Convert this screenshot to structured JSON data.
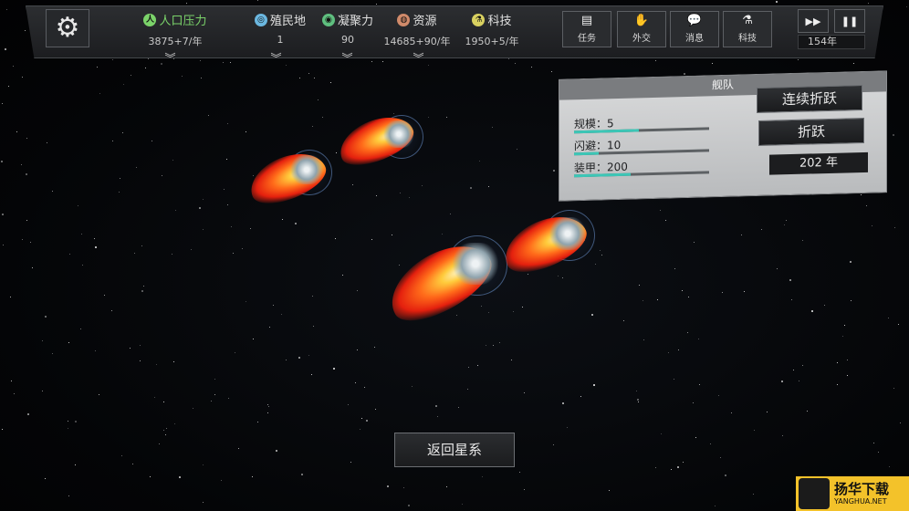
{
  "topbar": {
    "stats": [
      {
        "label": "人口压力",
        "value": "3875+7/年",
        "icon": "population-icon",
        "color": "#7bd36a"
      },
      {
        "label": "殖民地",
        "value": "1",
        "icon": "colony-icon",
        "color": "#6bb7e0"
      },
      {
        "label": "凝聚力",
        "value": "90",
        "icon": "cohesion-icon",
        "color": "#5fbf7f"
      },
      {
        "label": "资源",
        "value": "14685+90/年",
        "icon": "resource-icon",
        "color": "#d08a6a"
      },
      {
        "label": "科技",
        "value": "1950+5/年",
        "icon": "tech-icon",
        "color": "#d8d060"
      }
    ],
    "menu": [
      {
        "label": "任务",
        "icon": "mission-icon"
      },
      {
        "label": "外交",
        "icon": "diplomacy-icon"
      },
      {
        "label": "消息",
        "icon": "message-icon"
      },
      {
        "label": "科技",
        "icon": "flask-icon"
      }
    ],
    "year": "154年"
  },
  "panel": {
    "title": "舰队",
    "stats": [
      {
        "label": "规模：5",
        "fill": 0.48
      },
      {
        "label": "闪避：10",
        "fill": 0.18
      },
      {
        "label": "装甲：200",
        "fill": 0.42
      }
    ],
    "continuous_jump": "连续折跃",
    "jump": "折跃",
    "target_year": "202 年"
  },
  "return_label": "返回星系",
  "watermark": {
    "title": "扬华下载",
    "url": "YANGHUA.NET"
  }
}
